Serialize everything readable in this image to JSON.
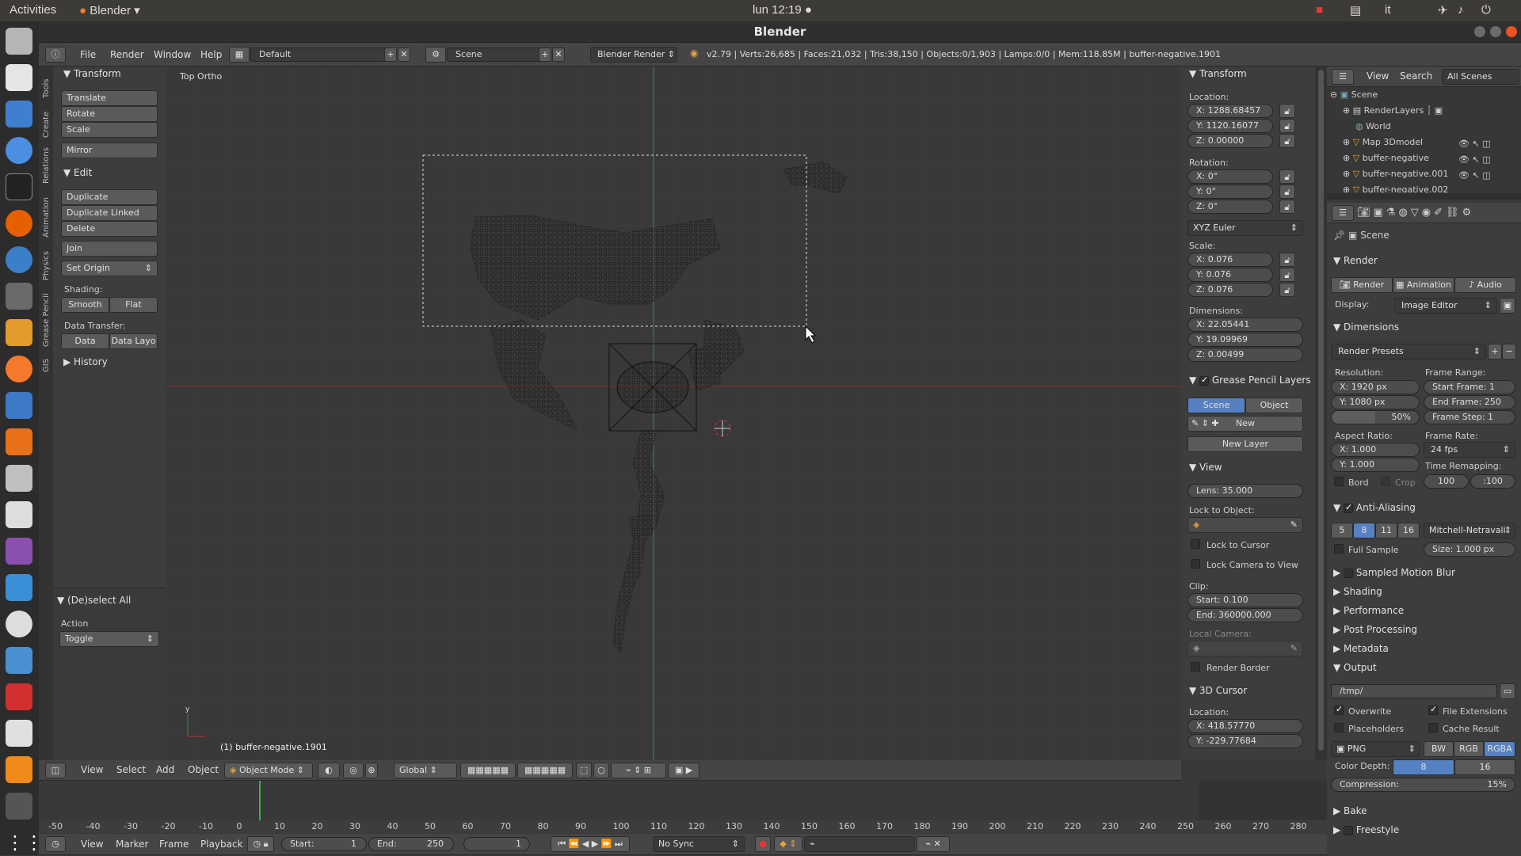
{
  "topbar": {
    "activities": "Activities",
    "app": "Blender",
    "clock": "lun 12:19 ●",
    "lang": "it"
  },
  "window": {
    "title": "Blender"
  },
  "info": {
    "menus": [
      "File",
      "Render",
      "Window",
      "Help"
    ],
    "layout": "Default",
    "scene": "Scene",
    "engine": "Blender Render",
    "stats": "v2.79 | Verts:26,685 | Faces:21,032 | Tris:38,150 | Objects:0/1,903 | Lamps:0/0 | Mem:118.85M | buffer-negative.1901"
  },
  "tools": {
    "tabs": [
      "Tools",
      "Create",
      "Relations",
      "Animation",
      "Physics",
      "Grease Pencil",
      "GIS"
    ],
    "transform_title": "Transform",
    "translate": "Translate",
    "rotate": "Rotate",
    "scale": "Scale",
    "mirror": "Mirror",
    "edit_title": "Edit",
    "duplicate": "Duplicate",
    "duplicate_linked": "Duplicate Linked",
    "delete": "Delete",
    "join": "Join",
    "set_origin": "Set Origin",
    "shading": "Shading:",
    "smooth": "Smooth",
    "flat": "Flat",
    "data_transfer": "Data Transfer:",
    "data": "Data",
    "data_layo": "Data Layo",
    "history": "History",
    "op_title": "(De)select All",
    "action": "Action",
    "toggle": "Toggle"
  },
  "viewport": {
    "view_name": "Top Ortho",
    "object_name": "(1) buffer-negative.1901",
    "menus": [
      "View",
      "Select",
      "Add",
      "Object"
    ],
    "mode": "Object Mode",
    "orientation": "Global"
  },
  "npanel": {
    "transform": "Transform",
    "location": "Location:",
    "loc": [
      "X: 1288.68457",
      "Y: 1120.16077",
      "Z: 0.00000"
    ],
    "rotation": "Rotation:",
    "rot": [
      "X: 0°",
      "Y: 0°",
      "Z: 0°"
    ],
    "euler": "XYZ Euler",
    "scale": "Scale:",
    "scl": [
      "X: 0.076",
      "Y: 0.076",
      "Z: 0.076"
    ],
    "dimensions": "Dimensions:",
    "dim": [
      "X: 22.05441",
      "Y: 19.09969",
      "Z: 0.00499"
    ],
    "gp_layers": "Grease Pencil Layers",
    "gp_scene": "Scene",
    "gp_object": "Object",
    "gp_new": "New",
    "gp_new_layer": "New Layer",
    "view": "View",
    "lens": "Lens: 35.000",
    "lock_obj": "Lock to Object:",
    "lock_cursor": "Lock to Cursor",
    "lock_cam": "Lock Camera to View",
    "clip": "Clip:",
    "clip_start": "Start: 0.100",
    "clip_end": "End: 360000.000",
    "local_cam": "Local Camera:",
    "render_border": "Render Border",
    "cursor": "3D Cursor",
    "cursor_loc": "Location:",
    "cur": [
      "X: 418.57770",
      "Y: -229.77684"
    ]
  },
  "outliner": {
    "view": "View",
    "search": "Search",
    "filter": "All Scenes",
    "items": [
      "Scene",
      "RenderLayers",
      "World",
      "Map 3Dmodel",
      "buffer-negative",
      "buffer-negative.001",
      "buffer-negative.002"
    ]
  },
  "props": {
    "context": "Scene",
    "render_title": "Render",
    "render_btn": "Render",
    "anim_btn": "Animation",
    "audio_btn": "Audio",
    "display": "Display:",
    "display_val": "Image Editor",
    "dimensions": "Dimensions",
    "presets": "Render Presets",
    "resolution": "Resolution:",
    "res_x": "X: 1920 px",
    "res_y": "Y: 1080 px",
    "res_pct": "50%",
    "frame_range": "Frame Range:",
    "start_frame": "Start Frame: 1",
    "end_frame": "End Frame: 250",
    "frame_step": "Frame Step: 1",
    "aspect": "Aspect Ratio:",
    "asp_x": "X: 1.000",
    "asp_y": "Y: 1.000",
    "frame_rate": "Frame Rate:",
    "fps": "24 fps",
    "time_remap": "Time Remapping:",
    "remap_old": "100",
    "remap_new": ":100",
    "bord": "Bord",
    "crop": "Crop",
    "aa": "Anti-Aliasing",
    "aa_samples": [
      "5",
      "8",
      "11",
      "16"
    ],
    "aa_filter": "Mitchell-Netravali",
    "full_sample": "Full Sample",
    "aa_size": "Size: 1.000 px",
    "motion_blur": "Sampled Motion Blur",
    "shading": "Shading",
    "performance": "Performance",
    "post": "Post Processing",
    "metadata": "Metadata",
    "output": "Output",
    "out_path": "/tmp/",
    "overwrite": "Overwrite",
    "file_ext": "File Extensions",
    "placeholders": "Placeholders",
    "cache": "Cache Result",
    "format": "PNG",
    "bw": "BW",
    "rgb": "RGB",
    "rgba": "RGBA",
    "color_depth": "Color Depth:",
    "d8": "8",
    "d16": "16",
    "compression": "Compression:",
    "comp_val": "15%",
    "bake": "Bake",
    "freestyle": "Freestyle"
  },
  "timeline": {
    "ticks": [
      "-50",
      "-40",
      "-30",
      "-20",
      "-10",
      "0",
      "10",
      "20",
      "30",
      "40",
      "50",
      "60",
      "70",
      "80",
      "90",
      "100",
      "110",
      "120",
      "130",
      "140",
      "150",
      "160",
      "170",
      "180",
      "190",
      "200",
      "210",
      "220",
      "230",
      "240",
      "250",
      "260",
      "270",
      "280"
    ],
    "menus": [
      "View",
      "Marker",
      "Frame",
      "Playback"
    ],
    "start": "Start:",
    "start_val": "1",
    "end": "End:",
    "end_val": "250",
    "current": "1",
    "sync": "No Sync"
  },
  "colors": {
    "accent": "#5680c2",
    "grid_x": "#8b2a2a",
    "grid_y": "#3a8a3a"
  }
}
